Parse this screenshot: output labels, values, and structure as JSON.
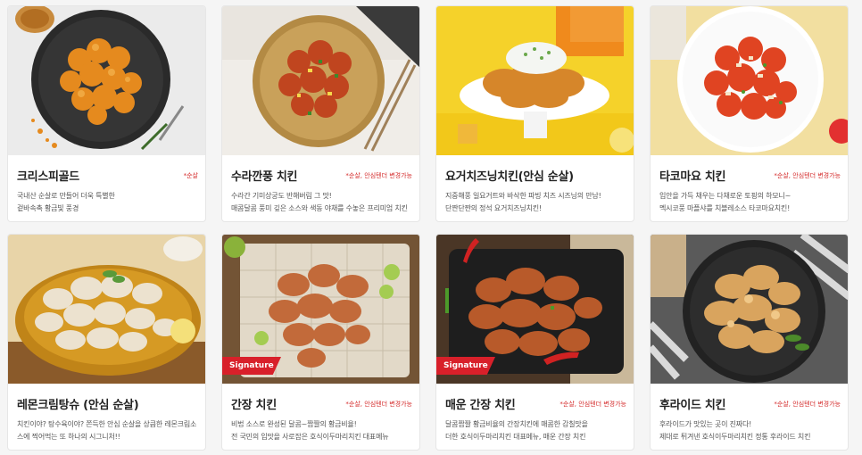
{
  "menu": [
    {
      "name": "크리스피골드",
      "badge": "*순살",
      "desc": [
        "국내산 순살로 만들어 더욱 특별한",
        "겉바속촉 황금빛 풍경"
      ],
      "signature": false,
      "colors": {
        "bg": "#ebebeb",
        "plate": "#2a2a2a",
        "food": "#e58a1e"
      }
    },
    {
      "name": "수라깐풍 치킨",
      "badge": "*순살, 안심텐더 변경가능",
      "desc": [
        "수라간 기미상궁도 반해버림 그 맛!",
        "매콤달콤 풍미 깊은 소스와 색동 야채를 수놓은 프리미엄 치킨"
      ],
      "signature": false,
      "colors": {
        "bg": "#3a3a3a",
        "plate": "#c9a15a",
        "food": "#c0451f"
      }
    },
    {
      "name": "요거치즈닝치킨(안심 순살)",
      "badge": "",
      "desc": [
        "지중해풍 일요거트와 바삭한 파빙 치즈 시즈닝의 만남!",
        "단짠단짠의 정석 요거치즈닝치킨!"
      ],
      "signature": false,
      "colors": {
        "bg": "#f5d22a",
        "plate": "#ffffff",
        "food": "#d6862a"
      }
    },
    {
      "name": "타코마요 치킨",
      "badge": "*순살, 안심텐더 변경가능",
      "desc": [
        "입안을 가득 채우는 다채로운 토핑의 하모니~",
        "멕시코풍 마플샤를 치블레소스 타코마요치킨!"
      ],
      "signature": false,
      "colors": {
        "bg": "#f2dfa0",
        "plate": "#ffffff",
        "food": "#e04422"
      }
    },
    {
      "name": "레몬크림탕슈 (안심 순살)",
      "badge": "",
      "desc": [
        "치킨이야? 탕수육이야? 쫀득한 안심 순살을 상큼한 레몬크림소",
        "스에 찍어먹는 또 하나의 시그니처!!"
      ],
      "signature": false,
      "colors": {
        "bg": "#e8d4a8",
        "plate": "#d69a24",
        "food": "#ece2cf"
      }
    },
    {
      "name": "간장 치킨",
      "badge": "*순살, 안심텐더 변경가능",
      "desc": [
        "비법 소스로 완성된 달콤~짭짤의 황금비율!",
        "전 국민의 입맛을 사로잡은 호식이두마리치킨 대표메뉴"
      ],
      "signature": true,
      "signature_label": "Signature",
      "colors": {
        "bg": "#7a5a3a",
        "plate": "#5c4a3a",
        "food": "#c26a3a"
      }
    },
    {
      "name": "매운 간장 치킨",
      "badge": "*순살, 안심텐더 변경가능",
      "desc": [
        "달콤짭짤 황금비율의 간장치킨에 매콤한 감칠맛을",
        "더한 호식이두마리치킨 대표메뉴, 매운 간장 치킨"
      ],
      "signature": true,
      "signature_label": "Signature",
      "colors": {
        "bg": "#4a3626",
        "plate": "#1e1e1e",
        "food": "#b85a2a"
      }
    },
    {
      "name": "후라이드 치킨",
      "badge": "*순살, 안심텐더 변경가능",
      "desc": [
        "후라이드가 맛있는 곳이 진짜다!",
        "제대로 튀겨낸 호식이두마리치킨 정통 후라이드 치킨"
      ],
      "signature": false,
      "colors": {
        "bg": "#5a5a5a",
        "plate": "#222222",
        "food": "#d9a45e"
      }
    }
  ]
}
